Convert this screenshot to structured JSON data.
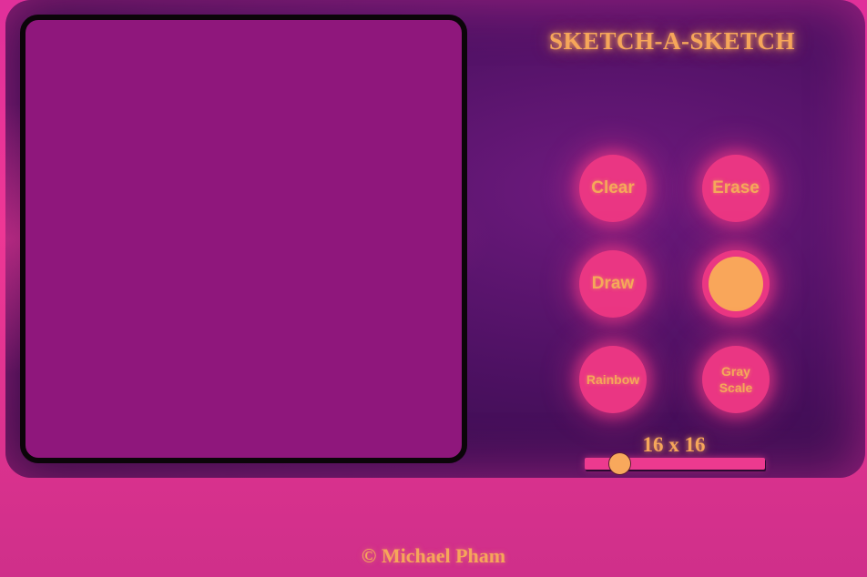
{
  "app": {
    "title": "SKETCH-A-SKETCH"
  },
  "controls": {
    "clear_label": "Clear",
    "erase_label": "Erase",
    "draw_label": "Draw",
    "rainbow_label": "Rainbow",
    "grayscale_label": "Gray Scale",
    "color_value": "#f9a65a"
  },
  "grid": {
    "size_label": "16 x 16",
    "slider_value": 16
  },
  "footer": {
    "copyright": "© Michael Pham"
  },
  "colors": {
    "accent": "#ea3683",
    "text_glow": "#f6a65a",
    "canvas": "#8f177c",
    "background": "#ee3795"
  }
}
